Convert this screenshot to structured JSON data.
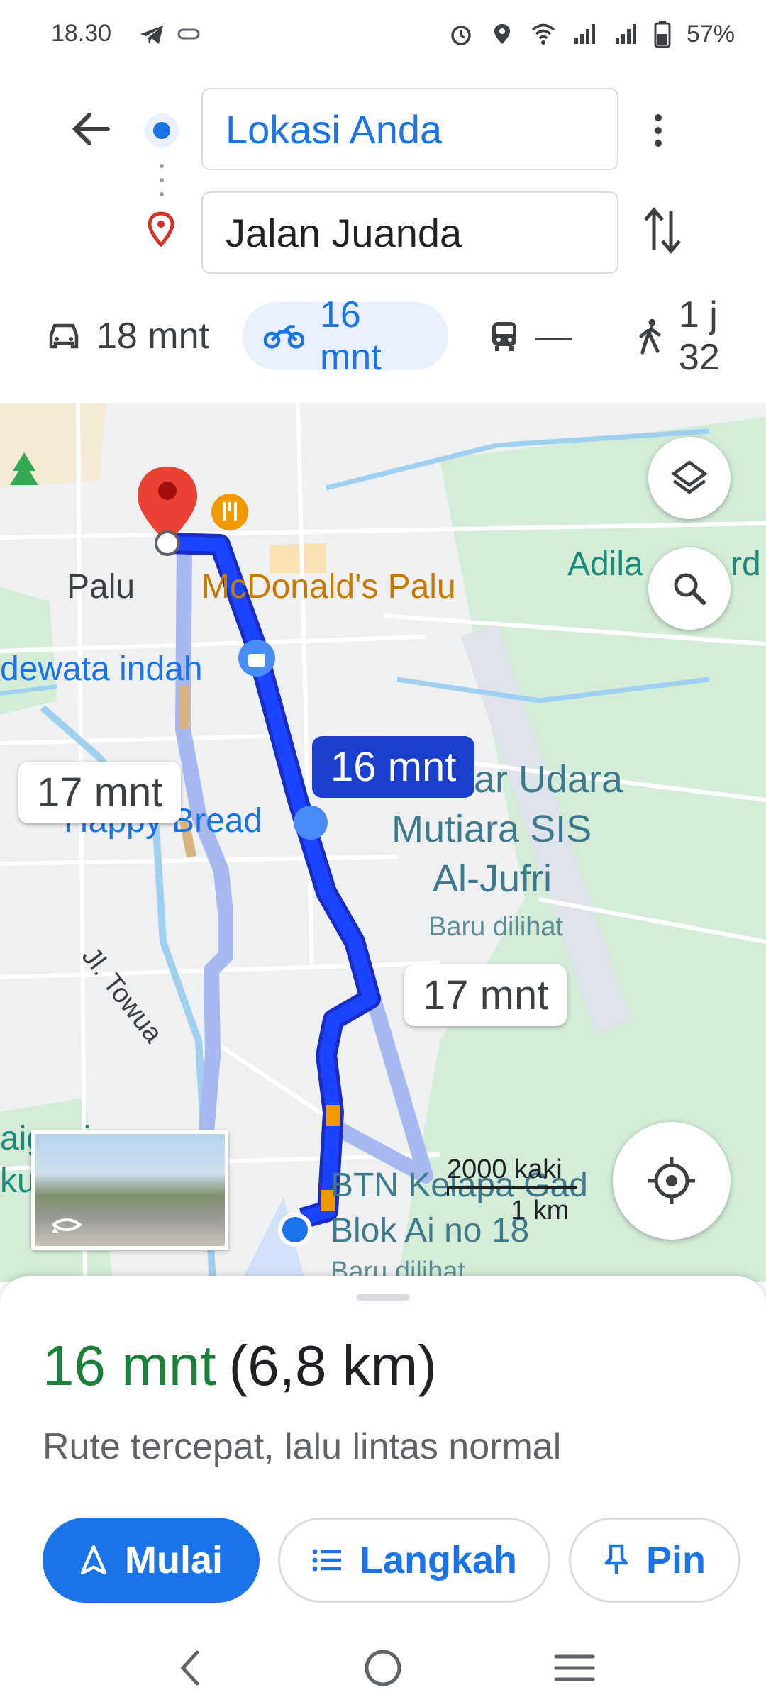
{
  "status_bar": {
    "time": "18.30",
    "battery": "57%"
  },
  "search": {
    "origin": "Lokasi Anda",
    "destination": "Jalan Juanda"
  },
  "modes": [
    {
      "icon": "car-icon",
      "label": "18 mnt"
    },
    {
      "icon": "motorcycle-icon",
      "label": "16 mnt",
      "selected": true
    },
    {
      "icon": "transit-icon",
      "label": "—"
    },
    {
      "icon": "walk-icon",
      "label": "1 j 32"
    }
  ],
  "map": {
    "labels": {
      "palu": "Palu",
      "mcdonalds": "McDonald's Palu",
      "adila": "Adila",
      "adila_suffix": "rd",
      "dewata": "dewata indah",
      "happy_bread": "Happy Bread",
      "bandar_udara": "ar Udara",
      "mutiara": "Mutiara SIS",
      "al_jufri": "Al-Jufri",
      "baru_dilihat": "Baru dilihat",
      "jl_towua": "Jl. Towua",
      "btn": "BTN Kelapa Gad",
      "blok": "Blok Ai no 18",
      "baru_dilihat_2": "Baru dilihat",
      "left_edge_1": "aigonia",
      "left_edge_2": "ku"
    },
    "route_bubbles": {
      "selected": "16 mnt",
      "alt_left": "17 mnt",
      "alt_right": "17 mnt"
    },
    "scale": {
      "feet": "2000 kaki",
      "km": "1 km"
    }
  },
  "sheet": {
    "duration": "16 mnt",
    "distance": "(6,8 km)",
    "description": "Rute tercepat, lalu lintas normal",
    "start_label": "Mulai",
    "steps_label": "Langkah",
    "pin_label": "Pin"
  },
  "colors": {
    "accent": "#1a73e8",
    "duration_green": "#188038",
    "route_primary": "#1a3fff",
    "route_alt": "#a8b8f0"
  }
}
